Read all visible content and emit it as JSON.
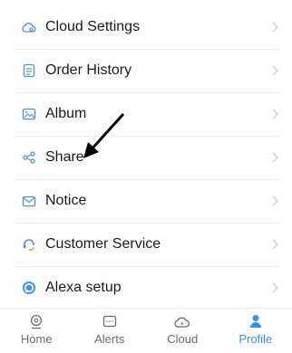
{
  "menu": {
    "items": [
      {
        "label": "Cloud Settings",
        "icon": "cloud-settings-icon"
      },
      {
        "label": "Order History",
        "icon": "order-history-icon"
      },
      {
        "label": "Album",
        "icon": "album-icon"
      },
      {
        "label": "Share",
        "icon": "share-icon"
      },
      {
        "label": "Notice",
        "icon": "mail-icon"
      },
      {
        "label": "Customer Service",
        "icon": "headset-icon"
      },
      {
        "label": "Alexa setup",
        "icon": "alexa-icon"
      }
    ]
  },
  "tabbar": {
    "tabs": [
      {
        "label": "Home",
        "icon": "home-camera-icon",
        "active": false
      },
      {
        "label": "Alerts",
        "icon": "alerts-icon",
        "active": false
      },
      {
        "label": "Cloud",
        "icon": "cloud-icon",
        "active": false
      },
      {
        "label": "Profile",
        "icon": "profile-icon",
        "active": true
      }
    ]
  },
  "colors": {
    "accent": "#3b8ff0",
    "icon": "#4a90e2",
    "text": "#1a1a1a",
    "muted": "#6b6b6b",
    "chevron": "#c4c4c4",
    "annotation_arrow": "#000000"
  }
}
